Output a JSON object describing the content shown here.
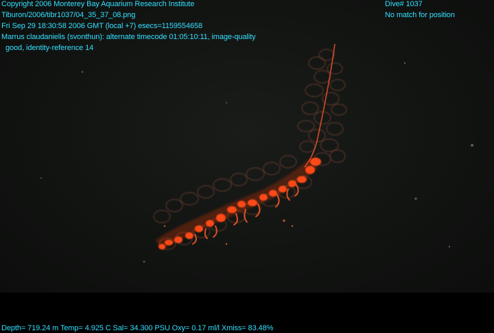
{
  "header": {
    "copyright": "Copyright 2006 Monterey Bay Aquarium Research Institute",
    "file_path": "Tiburon/2006/tibr1037/04_35_37_08.png",
    "datetime": "Fri Sep 29 18:30:58 2006 GMT (local +7)  esecs=1159554658",
    "annotation_line1": "Marrus claudanielis (svonthun): alternate timecode 01:05:10:11, image-quality",
    "annotation_line2": "good, identity-reference 14",
    "dive": "Dive# 1037",
    "position_status": "No match for position"
  },
  "footer": {
    "sensors": "Depth= 719.24 m  Temp= 4.925 C  Sal= 34.300 PSU  Oxy= 0.17 ml/l  Xmiss= 83.48%"
  },
  "colors": {
    "overlay_text": "#33e0ff",
    "background": "#000000",
    "water": "#141614",
    "organism": "#ff4a12"
  }
}
